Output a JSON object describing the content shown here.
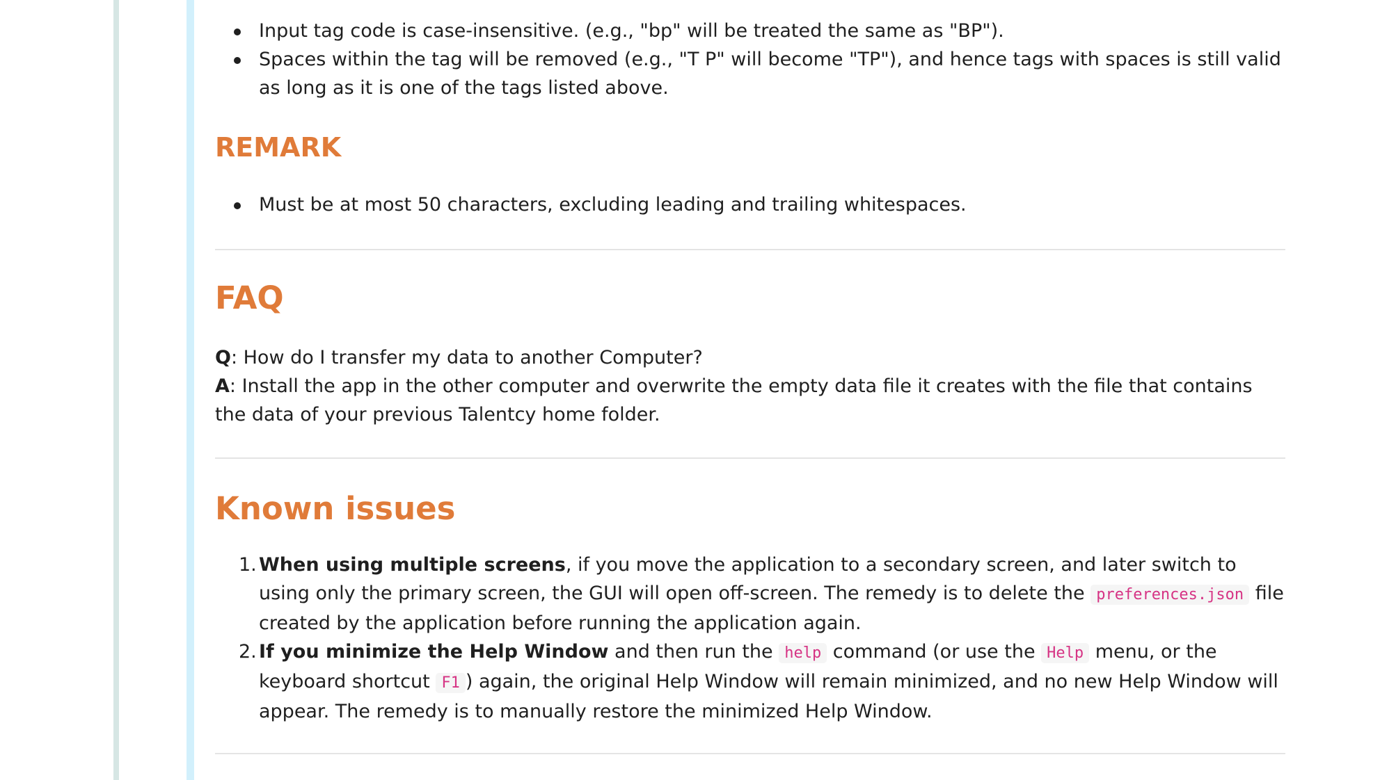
{
  "tags_notes": {
    "items": [
      "Input tag code is case-insensitive. (e.g., \"bp\" will be treated the same as \"BP\").",
      "Spaces within the tag will be removed (e.g., \"T P\" will become \"TP\"), and hence tags with spaces is still valid as long as it is one of the tags listed above."
    ]
  },
  "remark": {
    "heading": "REMARK",
    "items": [
      "Must be at most 50 characters, excluding leading and trailing whitespaces."
    ]
  },
  "faq": {
    "heading": "FAQ",
    "q_label": "Q",
    "q_text": ": How do I transfer my data to another Computer?",
    "a_label": "A",
    "a_text": ": Install the app in the other computer and overwrite the empty data file it creates with the file that contains the data of your previous Talentcy home folder."
  },
  "known_issues": {
    "heading": "Known issues",
    "items": [
      {
        "number": "1.",
        "bold": "When using multiple screens",
        "text_1": ", if you move the application to a secondary screen, and later switch to using only the primary screen, the GUI will open off-screen. The remedy is to delete the ",
        "code_1": "preferences.json",
        "text_2": " file created by the application before running the application again."
      },
      {
        "number": "2.",
        "bold": "If you minimize the Help Window",
        "text_1": " and then run the ",
        "code_1": "help",
        "text_2": " command (or use the ",
        "code_2": "Help",
        "text_3": " menu, or the keyboard shortcut ",
        "code_3": "F1",
        "text_4": ") again, the original Help Window will remain minimized, and no new Help Window will appear. The remedy is to manually restore the minimized Help Window."
      }
    ]
  }
}
